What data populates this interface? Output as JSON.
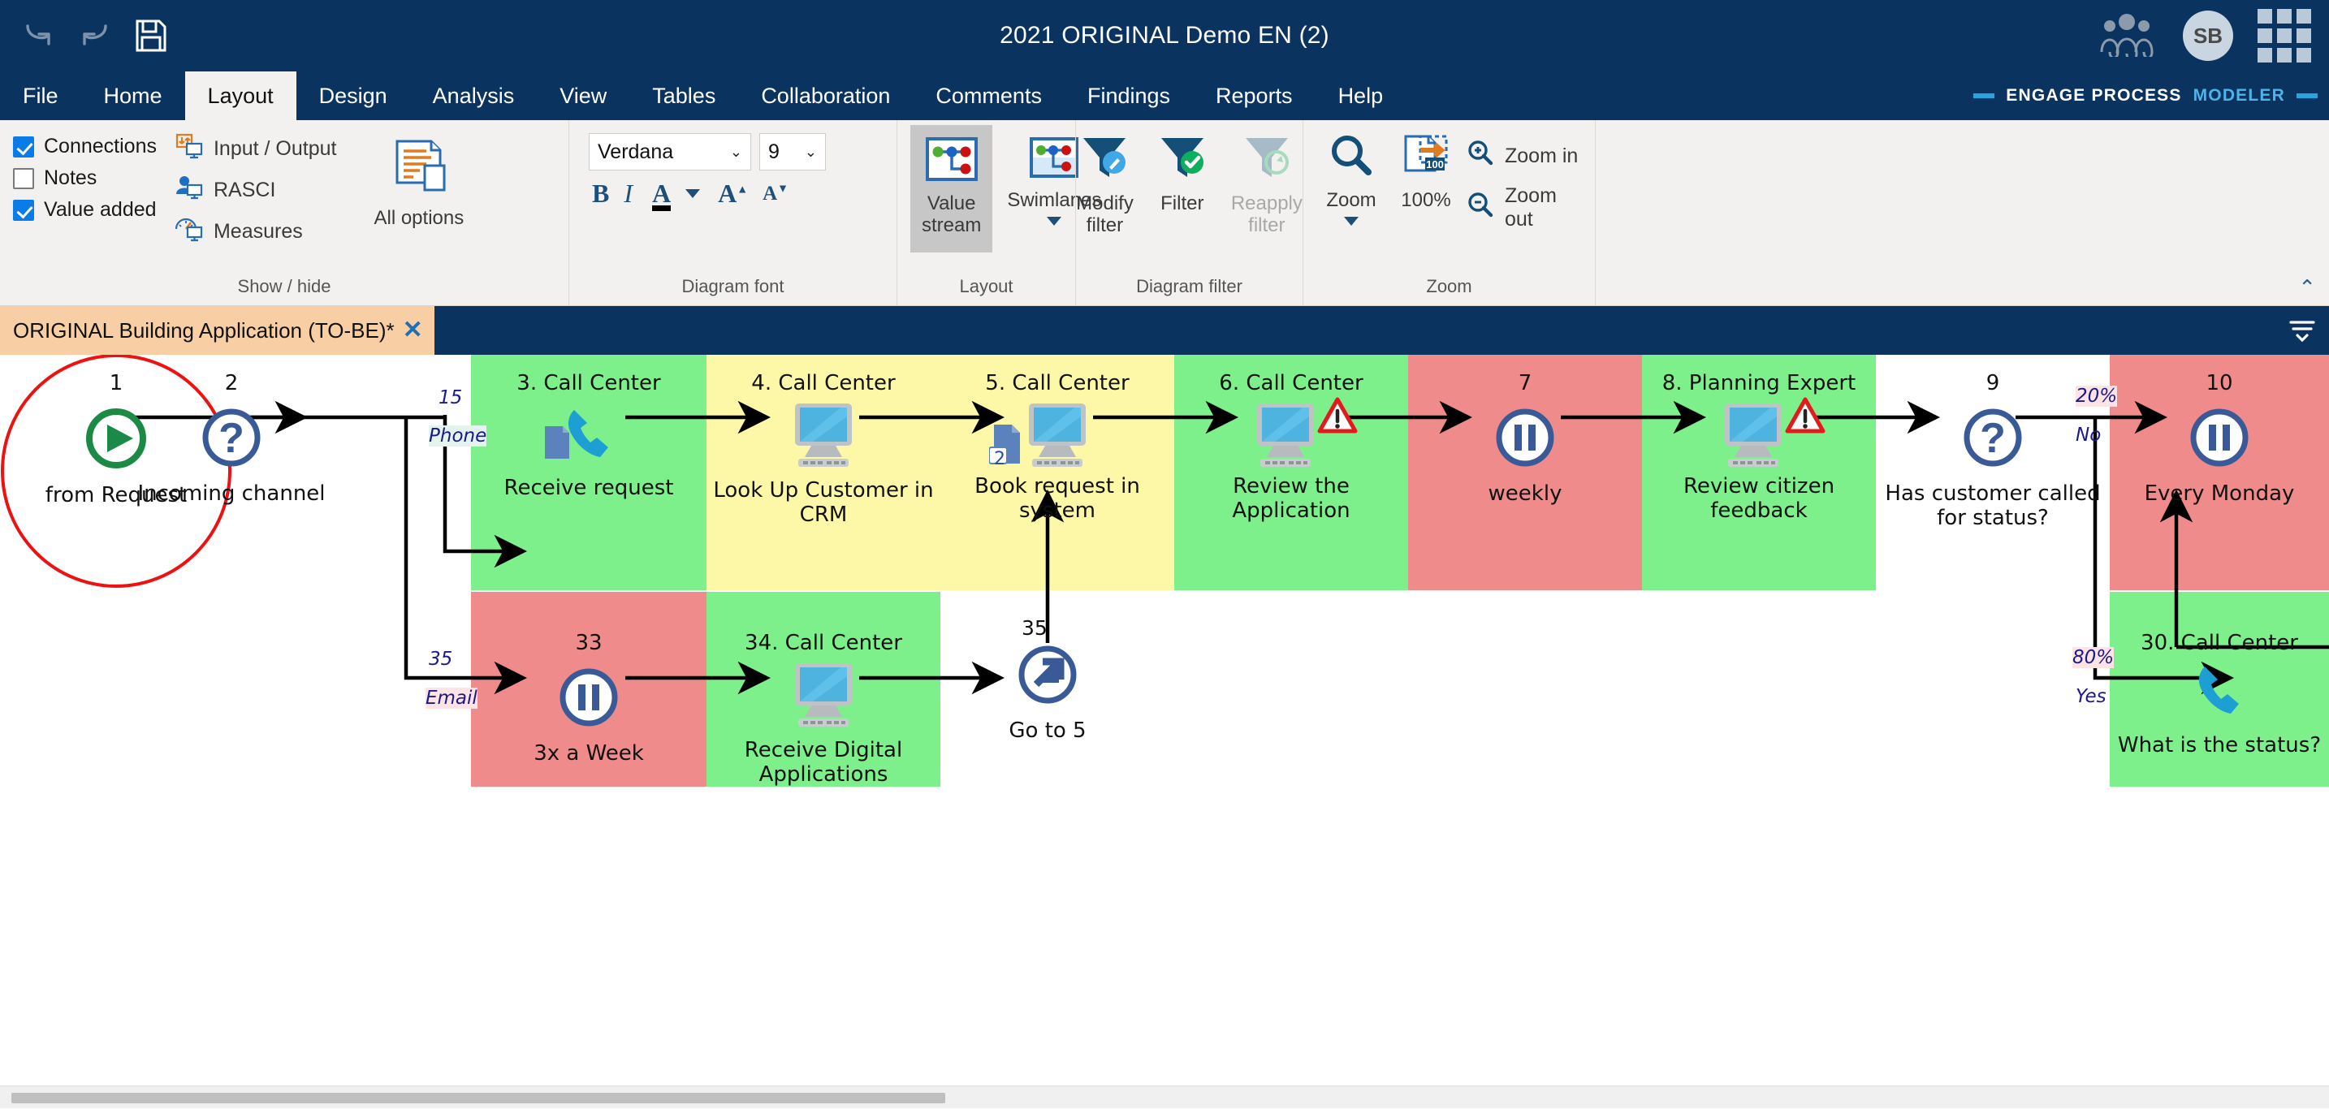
{
  "titlebar": {
    "document_title": "2021 ORIGINAL Demo EN (2)",
    "quick_access": [
      {
        "name": "undo-icon",
        "label": "Undo"
      },
      {
        "name": "redo-icon",
        "label": "Redo"
      },
      {
        "name": "save-icon",
        "label": "Save"
      }
    ],
    "avatar_initials": "SB",
    "people_icon": "people-icon",
    "apps_icon": "apps-grid-icon"
  },
  "menubar": {
    "tabs": [
      {
        "label": "File",
        "active": false
      },
      {
        "label": "Home",
        "active": false
      },
      {
        "label": "Layout",
        "active": true
      },
      {
        "label": "Design",
        "active": false
      },
      {
        "label": "Analysis",
        "active": false
      },
      {
        "label": "View",
        "active": false
      },
      {
        "label": "Tables",
        "active": false
      },
      {
        "label": "Collaboration",
        "active": false
      },
      {
        "label": "Comments",
        "active": false
      },
      {
        "label": "Findings",
        "active": false
      },
      {
        "label": "Reports",
        "active": false
      },
      {
        "label": "Help",
        "active": false
      }
    ],
    "brand_primary": "ENGAGE PROCESS",
    "brand_secondary": "MODELER"
  },
  "ribbon": {
    "groups": {
      "show_hide": {
        "label": "Show / hide",
        "checkboxes": [
          {
            "label": "Connections",
            "checked": true
          },
          {
            "label": "Notes",
            "checked": false
          },
          {
            "label": "Value added",
            "checked": true
          }
        ],
        "items": [
          {
            "label": "Input / Output",
            "icon": "input-output-icon"
          },
          {
            "label": "RASCI",
            "icon": "rasci-icon"
          },
          {
            "label": "Measures",
            "icon": "measures-icon"
          }
        ],
        "all_options_label": "All options",
        "all_options_icon": "all-options-icon"
      },
      "diagram_font": {
        "label": "Diagram font",
        "font_family_value": "Verdana",
        "font_size_value": "9",
        "bold_label": "B",
        "italic_label": "I",
        "font_color_label": "A",
        "grow_label": "A",
        "shrink_label": "A"
      },
      "layout": {
        "label": "Layout",
        "buttons": [
          {
            "label": "Value stream",
            "icon": "value-stream-icon",
            "selected": true
          },
          {
            "label": "Swimlanes",
            "icon": "swimlanes-icon",
            "selected": false,
            "has_dropdown": true
          }
        ]
      },
      "diagram_filter": {
        "label": "Diagram filter",
        "buttons": [
          {
            "label": "Modify\nfilter",
            "label_line1": "Modify",
            "label_line2": "filter",
            "icon": "funnel-edit-icon",
            "disabled": false
          },
          {
            "label": "Filter",
            "label_line1": "Filter",
            "label_line2": "",
            "icon": "funnel-check-icon",
            "disabled": false
          },
          {
            "label": "Reapply\nfilter",
            "label_line1": "Reapply",
            "label_line2": "filter",
            "icon": "funnel-reapply-icon",
            "disabled": true
          }
        ]
      },
      "zoom": {
        "label": "Zoom",
        "zoom_button_label": "Zoom",
        "zoom_button_icon": "magnifier-icon",
        "fit_label": "100%",
        "fit_icon": "fit-100-icon",
        "zoom_in_label": "Zoom in",
        "zoom_in_icon": "zoom-in-icon",
        "zoom_out_label": "Zoom out",
        "zoom_out_icon": "zoom-out-icon"
      }
    },
    "collapse_icon": "chevron-up-icon"
  },
  "tabstrip": {
    "tabs": [
      {
        "label": "ORIGINAL Building Application (TO-BE)*",
        "close_icon": "close-icon",
        "active": true
      }
    ],
    "options_icon": "tab-options-icon"
  },
  "diagram": {
    "lane_colors": {
      "green": "#7df08b",
      "yellow": "#fcf8a8",
      "red": "#f08b8b",
      "white": "#ffffff"
    },
    "nodes": [
      {
        "num": "1",
        "title": "",
        "caption": "from Request",
        "icon": "start-play-icon",
        "band": "white",
        "highlight": "red-ellipse"
      },
      {
        "num": "2",
        "title": "",
        "caption": "Incoming channel",
        "icon": "decision-question-icon",
        "band": "white"
      },
      {
        "num": "3. Call Center",
        "caption": "Receive request",
        "icon": "phone-icon",
        "band": "green",
        "doc_badge": ""
      },
      {
        "num": "4. Call Center",
        "caption": "Look Up Customer in CRM",
        "icon": "monitor-icon",
        "band": "yellow"
      },
      {
        "num": "5. Call Center",
        "caption": "Book request in system",
        "icon": "monitor-icon",
        "band": "yellow",
        "doc_badge": "2"
      },
      {
        "num": "6. Call Center",
        "caption": "Review the Application",
        "icon": "monitor-icon",
        "band": "green",
        "warning": "warning-icon"
      },
      {
        "num": "7",
        "caption": "weekly",
        "icon": "pause-icon",
        "band": "red"
      },
      {
        "num": "8. Planning Expert",
        "caption": "Review citizen feedback",
        "icon": "monitor-icon",
        "band": "green",
        "warning": "warning-icon"
      },
      {
        "num": "9",
        "caption": "Has customer called for status?",
        "icon": "decision-question-icon",
        "band": "white"
      },
      {
        "num": "10",
        "caption": "Every Monday",
        "icon": "pause-icon",
        "band": "red"
      },
      {
        "num": "33",
        "caption": "3x a Week",
        "icon": "pause-icon",
        "band": "red"
      },
      {
        "num": "34. Call Center",
        "caption": "Receive Digital Applications",
        "icon": "monitor-icon",
        "band": "green"
      },
      {
        "num": "",
        "caption": "Go to 5",
        "icon": "goto-arrow-icon",
        "band": "white"
      },
      {
        "num": "30. Call Center",
        "caption": "What is the status?",
        "icon": "phone-icon",
        "band": "green"
      }
    ],
    "edge_labels": [
      {
        "text": "15",
        "kind": "count"
      },
      {
        "text": "Phone",
        "kind": "branch"
      },
      {
        "text": "35",
        "kind": "count"
      },
      {
        "text": "Email",
        "kind": "branch"
      },
      {
        "text": "35",
        "kind": "count-black"
      },
      {
        "text": "20%",
        "kind": "percent"
      },
      {
        "text": "No",
        "kind": "branch"
      },
      {
        "text": "80%",
        "kind": "percent"
      },
      {
        "text": "Yes",
        "kind": "branch"
      }
    ]
  }
}
